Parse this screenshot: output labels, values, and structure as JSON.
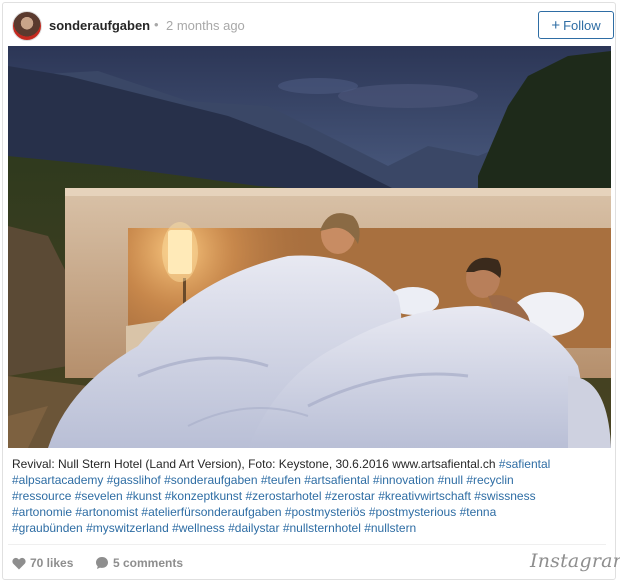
{
  "post": {
    "username": "sonderaufgaben",
    "separator": "•",
    "time_ago": "2 months ago",
    "follow_label": "Follow",
    "follow_icon": "plus-icon"
  },
  "caption": {
    "lines": [
      [
        {
          "text": "Revival: Null Stern Hotel (Land Art Version), Foto: Keystone, 30.6.2016 www.artsafiental.ch ",
          "tag": false
        },
        {
          "text": "#safiental",
          "tag": true
        }
      ],
      [
        {
          "text": "#alpsartacademy #gasslihof #sonderaufgaben #teufen #artsafiental #innovation #null #recyclin",
          "tag": true
        }
      ],
      [
        {
          "text": "#ressource #sevelen #kunst #konzeptkunst #zerostarhotel #zerostar #kreativwirtschaft #swissness",
          "tag": true
        }
      ],
      [
        {
          "text": "#artonomie #artonomist #atelierfürsonderaufgaben #postmysteriös #postmysterious #tenna",
          "tag": true
        }
      ],
      [
        {
          "text": "#graubünden #myswitzerland #wellness #dailystar #nullsternhotel #nullstern",
          "tag": true
        }
      ]
    ]
  },
  "footer": {
    "likes": "70 likes",
    "comments": "5 comments",
    "heart_icon": "heart-icon",
    "comment_icon": "comment-icon",
    "brand": "Instagram"
  },
  "colors": {
    "accent": "#2e6da4",
    "muted": "#8e8e8e",
    "text": "#262626"
  }
}
